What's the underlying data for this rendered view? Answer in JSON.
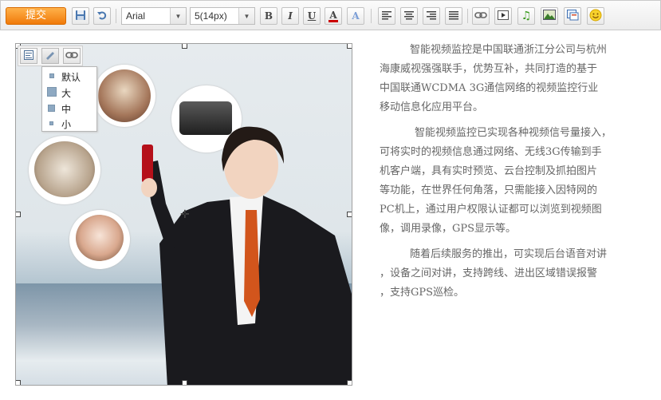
{
  "toolbar": {
    "submit_label": "提交",
    "font_family": "Arial",
    "font_size": "5(14px)",
    "bold_glyph": "B",
    "italic_glyph": "I",
    "underline_glyph": "U",
    "font_color_glyph": "A",
    "highlight_glyph": "A",
    "icons": [
      "save-icon",
      "undo-icon",
      "bold-icon",
      "italic-icon",
      "underline-icon",
      "font-color-icon",
      "highlight-icon",
      "align-left-icon",
      "align-center-icon",
      "align-right-icon",
      "justify-icon",
      "link-icon",
      "video-icon",
      "music-icon",
      "image-icon",
      "screenshot-icon",
      "emoji-icon"
    ],
    "colors": {
      "submit": "#f07a0a",
      "font_color_bar": "#cc0000",
      "music_icon": "#3a9a1e",
      "emoji_icon": "#f2c400"
    }
  },
  "image_toolbar": {
    "icons": [
      "align-icon",
      "resize-icon",
      "link-icon"
    ]
  },
  "size_menu": {
    "items": [
      {
        "label": "默认"
      },
      {
        "label": "大"
      },
      {
        "label": "中"
      },
      {
        "label": "小"
      }
    ]
  },
  "content": {
    "paragraphs": [
      [
        "智能视频监控是中国联通浙江分公司与杭州",
        "海康威视强强联手，优势互补，共同打造的基于",
        "中国联通WCDMA 3G通信网络的视频监控行业",
        "移动信息化应用平台。"
      ],
      [
        "智能视频监控已实现各种视频信号量接入，",
        "可将实时的视频信息通过网络、无线3G传输到手",
        "机客户端，具有实时预览、云台控制及抓拍图片",
        "等功能，在世界任何角落，只需能接入因特网的",
        "PC机上，通过用户权限认证都可以浏览到视频图",
        "像，调用录像，GPS显示等。"
      ],
      [
        "随着后续服务的推出，可实现后台语音对讲",
        "，设备之间对讲，支持跨线、进出区域错误报警",
        "，支持GPS巡检。"
      ]
    ]
  }
}
